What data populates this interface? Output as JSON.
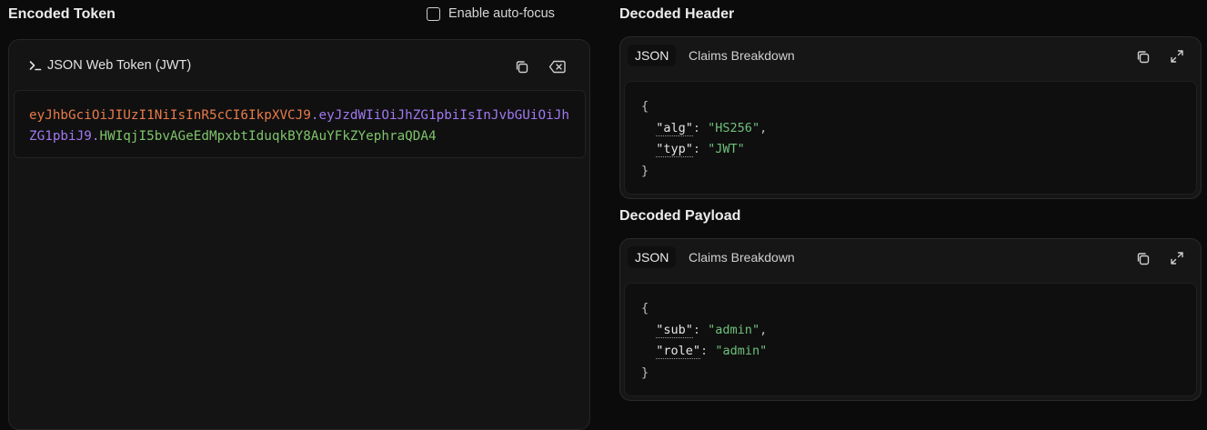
{
  "left": {
    "title": "Encoded Token",
    "autofocus_label": "Enable auto-focus",
    "panel_title": "JSON Web Token (JWT)",
    "token": {
      "header": "eyJhbGciOiJIUzI1NiIsInR5cCI6IkpXVCJ9",
      "payload": "eyJzdWIiOiJhZG1pbiIsInJvbGUiOiJhZG1pbiJ9",
      "signature": "HWIqjI5bvAGeEdMpxbtIduqkBY8AuYFkZYephraQDA4",
      "separator": "."
    }
  },
  "header_card": {
    "title": "Decoded Header",
    "tab_json": "JSON",
    "tab_claims": "Claims Breakdown",
    "open_brace": "{",
    "close_brace": "}",
    "lines": [
      {
        "key": "\"alg\"",
        "value": "\"HS256\"",
        "trail": ","
      },
      {
        "key": "\"typ\"",
        "value": "\"JWT\"",
        "trail": ""
      }
    ]
  },
  "payload_card": {
    "title": "Decoded Payload",
    "tab_json": "JSON",
    "tab_claims": "Claims Breakdown",
    "open_brace": "{",
    "close_brace": "}",
    "lines": [
      {
        "key": "\"sub\"",
        "value": "\"admin\"",
        "trail": ","
      },
      {
        "key": "\"role\"",
        "value": "\"admin\"",
        "trail": ""
      }
    ]
  },
  "colors": {
    "header_segment": "#e87a4a",
    "payload_segment": "#a078f0",
    "signature_segment": "#7ec46b",
    "json_string": "#6fc07c"
  }
}
